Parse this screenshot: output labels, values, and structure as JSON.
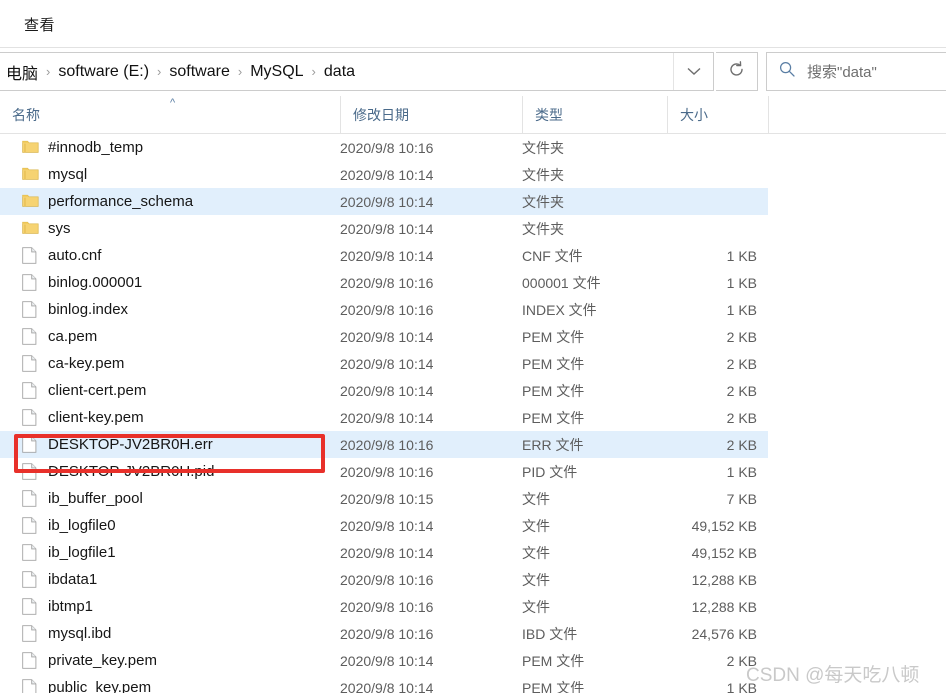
{
  "ribbon": {
    "tab_label": "查看"
  },
  "address_bar": {
    "breadcrumbs": [
      "电脑",
      "software (E:)",
      "software",
      "MySQL",
      "data"
    ],
    "separator": "›",
    "dropdown_icon": "chevron-down-icon",
    "refresh_icon": "refresh-icon"
  },
  "search": {
    "icon": "search-icon",
    "placeholder": "搜索\"data\""
  },
  "columns": {
    "name": "名称",
    "date_modified": "修改日期",
    "type": "类型",
    "size": "大小",
    "sort_indicator": "^"
  },
  "colors": {
    "selection": "#e1effc",
    "annotation": "#e8302a",
    "folder": "#f6d372",
    "header_text": "#4a6a8a"
  },
  "files": [
    {
      "name": "#innodb_temp",
      "date": "2020/9/8 10:16",
      "type": "文件夹",
      "size": "",
      "icon": "folder-icon",
      "selected": false
    },
    {
      "name": "mysql",
      "date": "2020/9/8 10:14",
      "type": "文件夹",
      "size": "",
      "icon": "folder-icon",
      "selected": false
    },
    {
      "name": "performance_schema",
      "date": "2020/9/8 10:14",
      "type": "文件夹",
      "size": "",
      "icon": "folder-icon",
      "selected": true
    },
    {
      "name": "sys",
      "date": "2020/9/8 10:14",
      "type": "文件夹",
      "size": "",
      "icon": "folder-icon",
      "selected": false
    },
    {
      "name": "auto.cnf",
      "date": "2020/9/8 10:14",
      "type": "CNF 文件",
      "size": "1 KB",
      "icon": "file-icon",
      "selected": false
    },
    {
      "name": "binlog.000001",
      "date": "2020/9/8 10:16",
      "type": "000001 文件",
      "size": "1 KB",
      "icon": "file-icon",
      "selected": false
    },
    {
      "name": "binlog.index",
      "date": "2020/9/8 10:16",
      "type": "INDEX 文件",
      "size": "1 KB",
      "icon": "file-icon",
      "selected": false
    },
    {
      "name": "ca.pem",
      "date": "2020/9/8 10:14",
      "type": "PEM 文件",
      "size": "2 KB",
      "icon": "file-icon",
      "selected": false
    },
    {
      "name": "ca-key.pem",
      "date": "2020/9/8 10:14",
      "type": "PEM 文件",
      "size": "2 KB",
      "icon": "file-icon",
      "selected": false
    },
    {
      "name": "client-cert.pem",
      "date": "2020/9/8 10:14",
      "type": "PEM 文件",
      "size": "2 KB",
      "icon": "file-icon",
      "selected": false
    },
    {
      "name": "client-key.pem",
      "date": "2020/9/8 10:14",
      "type": "PEM 文件",
      "size": "2 KB",
      "icon": "file-icon",
      "selected": false
    },
    {
      "name": "DESKTOP-JV2BR0H.err",
      "date": "2020/9/8 10:16",
      "type": "ERR 文件",
      "size": "2 KB",
      "icon": "file-icon",
      "selected": true
    },
    {
      "name": "DESKTOP-JV2BR0H.pid",
      "date": "2020/9/8 10:16",
      "type": "PID 文件",
      "size": "1 KB",
      "icon": "file-icon",
      "selected": false
    },
    {
      "name": "ib_buffer_pool",
      "date": "2020/9/8 10:15",
      "type": "文件",
      "size": "7 KB",
      "icon": "file-icon",
      "selected": false
    },
    {
      "name": "ib_logfile0",
      "date": "2020/9/8 10:14",
      "type": "文件",
      "size": "49,152 KB",
      "icon": "file-icon",
      "selected": false
    },
    {
      "name": "ib_logfile1",
      "date": "2020/9/8 10:14",
      "type": "文件",
      "size": "49,152 KB",
      "icon": "file-icon",
      "selected": false
    },
    {
      "name": "ibdata1",
      "date": "2020/9/8 10:16",
      "type": "文件",
      "size": "12,288 KB",
      "icon": "file-icon",
      "selected": false
    },
    {
      "name": "ibtmp1",
      "date": "2020/9/8 10:16",
      "type": "文件",
      "size": "12,288 KB",
      "icon": "file-icon",
      "selected": false
    },
    {
      "name": "mysql.ibd",
      "date": "2020/9/8 10:16",
      "type": "IBD 文件",
      "size": "24,576 KB",
      "icon": "file-icon",
      "selected": false
    },
    {
      "name": "private_key.pem",
      "date": "2020/9/8 10:14",
      "type": "PEM 文件",
      "size": "2 KB",
      "icon": "file-icon",
      "selected": false
    },
    {
      "name": "public_key.pem",
      "date": "2020/9/8 10:14",
      "type": "PEM 文件",
      "size": "1 KB",
      "icon": "file-icon",
      "selected": false
    }
  ],
  "annotation": {
    "target_row": "DESKTOP-JV2BR0H.err"
  },
  "watermark": {
    "text": "CSDN @每天吃八顿"
  }
}
